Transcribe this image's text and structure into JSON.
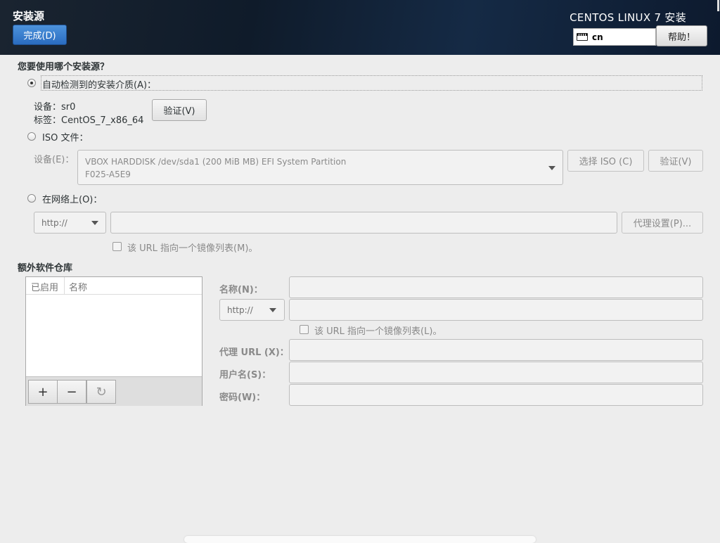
{
  "header": {
    "title": "安装源",
    "done_label": "完成(D)",
    "product": "CENTOS LINUX 7 安装",
    "keyboard_layout": "cn",
    "help_label": "帮助！"
  },
  "source": {
    "question": "您要使用哪个安装源？",
    "auto_detect_label": "自动检测到的安装介质(A)：",
    "device_line": "设备：sr0",
    "label_line": "标签：CentOS_7_x86_64",
    "verify_label": "验证(V)",
    "iso_label": "ISO 文件：",
    "iso_device_label": "设备(E)：",
    "iso_device_value_line1": "VBOX HARDDISK /dev/sda1 (200 MiB MB) EFI System Partition",
    "iso_device_value_line2": "F025-A5E9",
    "choose_iso_label": "选择 ISO (C)",
    "iso_verify_label": "验证(V)",
    "network_label": "在网络上(O)：",
    "protocol_value": "http://",
    "url_value": "",
    "proxy_label": "代理设置(P)...",
    "mirror_checkbox_label": "该 URL 指向一个镜像列表(M)。",
    "selected": "auto"
  },
  "repos": {
    "heading": "额外软件仓库",
    "col_enabled": "已启用",
    "col_name": "名称",
    "add_label": "+",
    "remove_label": "−",
    "refresh_label": "↻",
    "name_label": "名称(N)：",
    "name_value": "",
    "protocol_value": "http://",
    "url_value": "",
    "mirror_label": "该 URL 指向一个镜像列表(L)。",
    "proxy_url_label": "代理 URL (X)：",
    "proxy_url_value": "",
    "username_label": "用户名(S)：",
    "username_value": "",
    "password_label": "密码(W)：",
    "password_value": ""
  }
}
